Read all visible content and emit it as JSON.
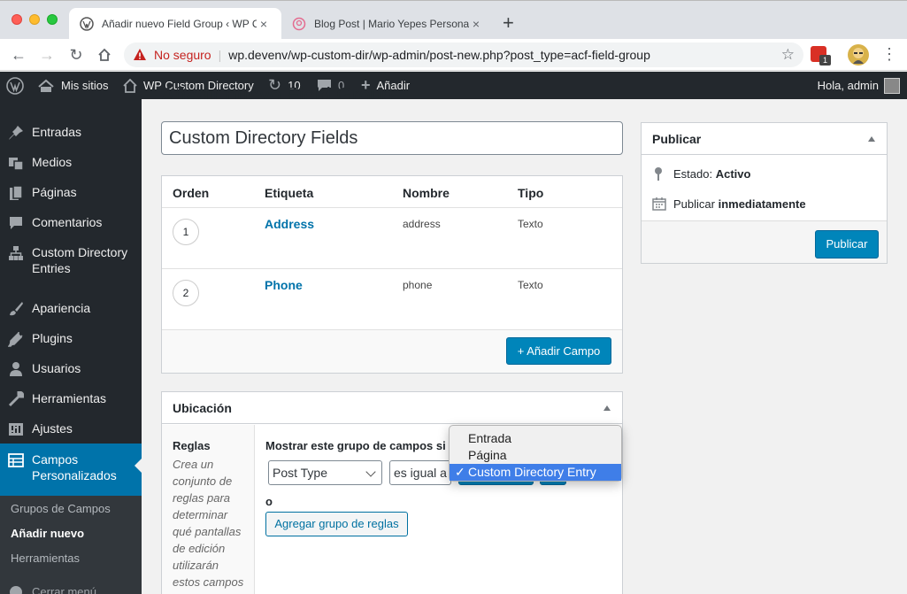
{
  "browser": {
    "tabs": [
      {
        "title": "Añadir nuevo Field Group ‹ WP C",
        "active": true
      },
      {
        "title": "Blog Post | Mario Yepes Persona",
        "active": false
      }
    ],
    "close_glyph": "×",
    "new_tab_glyph": "+",
    "security_label": "No seguro",
    "url": "wp.devenv/wp-custom-dir/wp-admin/post-new.php?post_type=acf-field-group",
    "extension_badge": "1"
  },
  "adminbar": {
    "my_sites": "Mis sitios",
    "site_name": "WP Custom Directory",
    "updates_count": "10",
    "comments_count": "0",
    "add_new": "Añadir",
    "greeting": "Hola, admin"
  },
  "sidebar": {
    "items": [
      {
        "label": "Entradas",
        "icon": "pin-icon"
      },
      {
        "label": "Medios",
        "icon": "media-icon"
      },
      {
        "label": "Páginas",
        "icon": "pages-icon"
      },
      {
        "label": "Comentarios",
        "icon": "comments-icon"
      },
      {
        "label": "Custom Directory Entries",
        "icon": "sitemap-icon"
      },
      {
        "label": "Apariencia",
        "icon": "brush-icon"
      },
      {
        "label": "Plugins",
        "icon": "plug-icon"
      },
      {
        "label": "Usuarios",
        "icon": "user-icon"
      },
      {
        "label": "Herramientas",
        "icon": "wrench-icon"
      },
      {
        "label": "Ajustes",
        "icon": "settings-icon"
      },
      {
        "label": "Campos Personalizados",
        "icon": "table-icon",
        "current": true
      }
    ],
    "submenu": [
      "Grupos de Campos",
      "Añadir nuevo",
      "Herramientas"
    ],
    "collapse": "Cerrar menú"
  },
  "page": {
    "title": "Añadir nuevo Field Group",
    "group_title_value": "Custom Directory Fields"
  },
  "fields": {
    "headers": {
      "order": "Orden",
      "label": "Etiqueta",
      "name": "Nombre",
      "type": "Tipo"
    },
    "rows": [
      {
        "order": "1",
        "label": "Address",
        "name": "address",
        "type": "Texto"
      },
      {
        "order": "2",
        "label": "Phone",
        "name": "phone",
        "type": "Texto"
      }
    ],
    "add_button": "+ Añadir Campo"
  },
  "location": {
    "title": "Ubicación",
    "rules_title": "Reglas",
    "rules_desc": "Crea un conjunto de reglas para determinar qué pantallas de edición utilizarán estos campos",
    "show_label": "Mostrar este grupo de campos si",
    "param_value": "Post Type",
    "operator_value": "es igual a",
    "or_label": "o",
    "add_group_button": "Agregar grupo de reglas",
    "dropdown_options": [
      {
        "label": "Entrada",
        "selected": false
      },
      {
        "label": "Página",
        "selected": false
      },
      {
        "label": "Custom Directory Entry",
        "selected": true
      }
    ],
    "check_glyph": "✓"
  },
  "publish": {
    "title": "Publicar",
    "status_label": "Estado:",
    "status_value": "Activo",
    "publish_label": "Publicar",
    "publish_value": "inmediatamente",
    "button": "Publicar"
  },
  "colors": {
    "wp_blue": "#0073aa",
    "admin_dark": "#23282d",
    "insecure_red": "#c5221f"
  }
}
